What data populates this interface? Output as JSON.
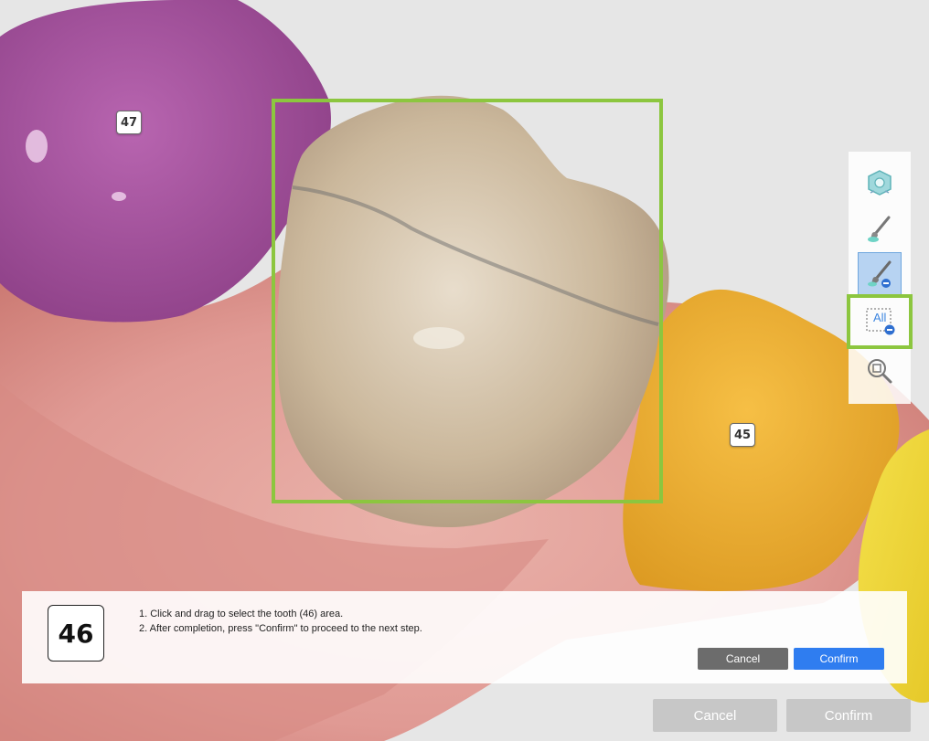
{
  "viewport": {
    "teeth_labels": [
      {
        "id": "tooth-47",
        "label": "47"
      },
      {
        "id": "tooth-45",
        "label": "45"
      }
    ],
    "colors": {
      "background": "#e6e6e6",
      "gum": "#e09a94",
      "tooth_47": "#a0509a",
      "tooth_46": "#c9b69a",
      "tooth_45": "#f0b030",
      "tooth_44": "#efd83a",
      "selection_box": "#8cc63f"
    }
  },
  "toolbar": {
    "tools": [
      {
        "name": "view-reset-icon",
        "active": false
      },
      {
        "name": "brush-add-icon",
        "active": false
      },
      {
        "name": "brush-remove-icon",
        "active": true
      },
      {
        "name": "select-all-remove-icon",
        "label": "All",
        "active": false
      },
      {
        "name": "zoom-fit-icon",
        "active": false
      }
    ]
  },
  "instruction_panel": {
    "tooth_number": "46",
    "line1": "1. Click and drag to select the tooth (46) area.",
    "line2": "2. After completion, press \"Confirm\" to proceed to the next step.",
    "cancel_label": "Cancel",
    "confirm_label": "Confirm"
  },
  "footer": {
    "cancel_label": "Cancel",
    "confirm_label": "Confirm"
  }
}
